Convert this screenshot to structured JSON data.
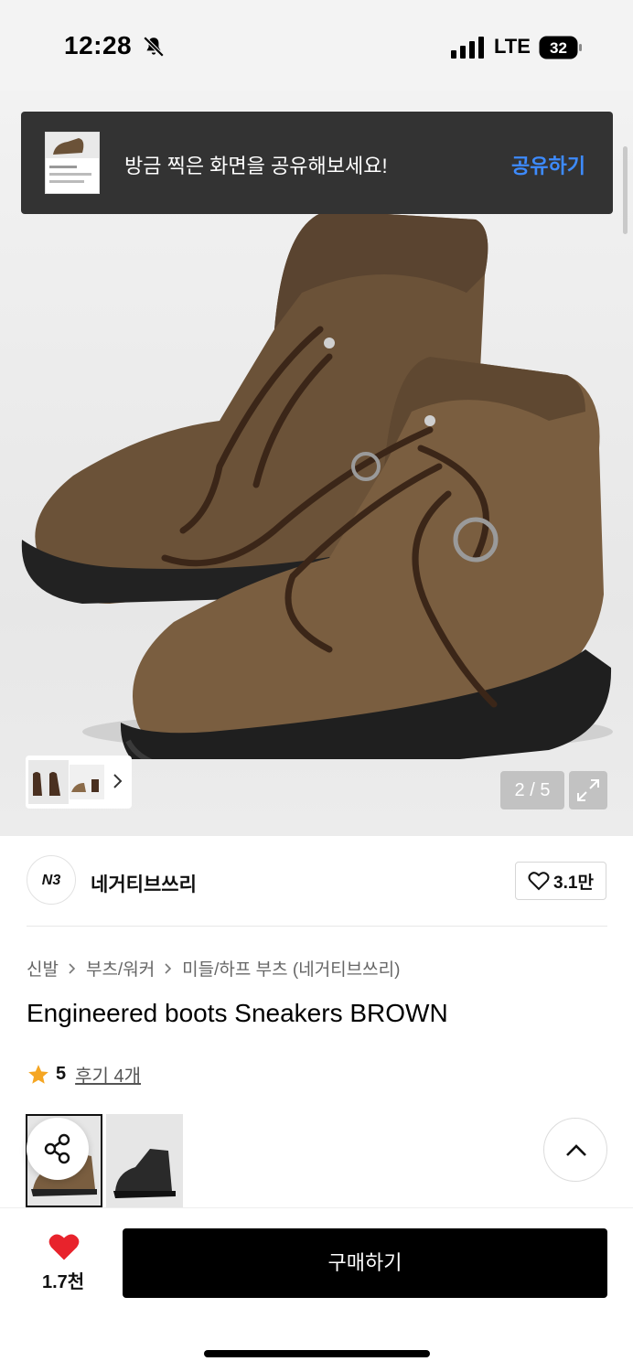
{
  "status_bar": {
    "time": "12:28",
    "network": "LTE",
    "battery": "32"
  },
  "toast": {
    "message": "방금 찍은 화면을 공유해보세요!",
    "action": "공유하기"
  },
  "gallery": {
    "counter": "2 / 5"
  },
  "brand": {
    "logo_text": "N3",
    "name": "네거티브쓰리",
    "likes": "3.1만"
  },
  "breadcrumb": [
    "신발",
    "부츠/워커",
    "미들/하프 부츠 (네거티브쓰리)"
  ],
  "product": {
    "title": "Engineered boots Sneakers BROWN",
    "rating": "5",
    "reviews": "후기 4개"
  },
  "bottom": {
    "wish_count": "1.7천",
    "buy_label": "구매하기"
  },
  "colors": {
    "accent_blue": "#3d8bff",
    "heart_red": "#e8232c",
    "star": "#f5a623"
  }
}
